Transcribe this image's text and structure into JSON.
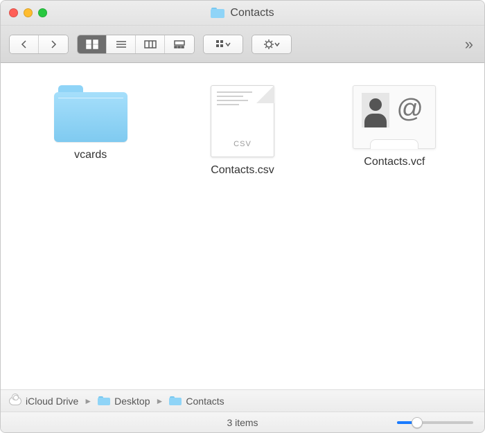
{
  "window": {
    "title": "Contacts"
  },
  "toolbar": {
    "view_mode": "icon"
  },
  "items": [
    {
      "kind": "folder",
      "label": "vcards"
    },
    {
      "kind": "csv",
      "label": "Contacts.csv",
      "ext": "csv"
    },
    {
      "kind": "vcf",
      "label": "Contacts.vcf"
    }
  ],
  "path": [
    {
      "label": "iCloud Drive",
      "icon": "cloud"
    },
    {
      "label": "Desktop",
      "icon": "folder"
    },
    {
      "label": "Contacts",
      "icon": "folder"
    }
  ],
  "status": {
    "text": "3 items"
  },
  "zoom": {
    "percent": 26
  }
}
